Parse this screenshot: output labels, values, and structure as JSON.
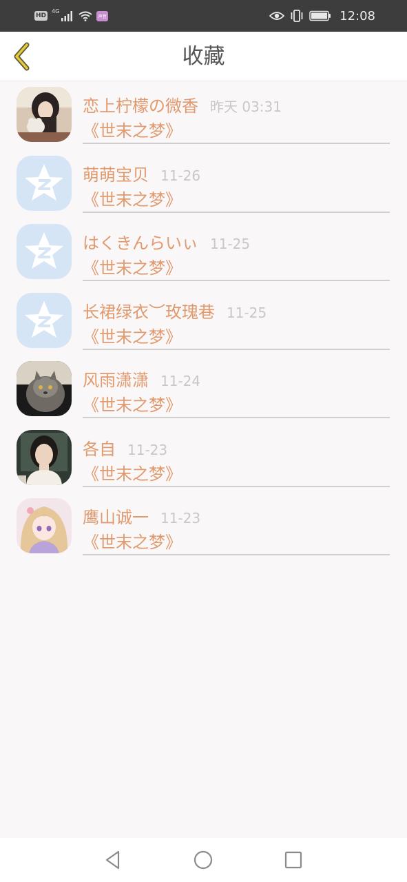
{
  "status_bar": {
    "hd_label": "HD",
    "network_label": "4G",
    "app_badge_label": "声音",
    "time": "12:08",
    "icons": [
      "signal-icon",
      "wifi-icon",
      "eye-icon",
      "vibrate-icon",
      "battery-icon"
    ]
  },
  "header": {
    "title": "收藏",
    "back_icon": "chevron-left-icon",
    "back_color": "#e8c93a"
  },
  "favorites": [
    {
      "name": "恋上柠檬の微香",
      "time": "昨天 03:31",
      "book": "《世末之梦》",
      "avatar": "photo-girl-with-toy"
    },
    {
      "name": "萌萌宝贝",
      "time": "11-26",
      "book": "《世末之梦》",
      "avatar": "qq-default-avatar"
    },
    {
      "name": "はくきんらいぃ",
      "time": "11-25",
      "book": "《世末之梦》",
      "avatar": "qq-default-avatar"
    },
    {
      "name": "长裙绿衣︶玫瑰巷",
      "time": "11-25",
      "book": "《世末之梦》",
      "avatar": "qq-default-avatar"
    },
    {
      "name": "风雨潇潇",
      "time": "11-24",
      "book": "《世末之梦》",
      "avatar": "photo-cat"
    },
    {
      "name": "各自",
      "time": "11-23",
      "book": "《世末之梦》",
      "avatar": "photo-girl-portrait"
    },
    {
      "name": "鹰山诚一",
      "time": "11-23",
      "book": "《世末之梦》",
      "avatar": "anime-girl-illustration"
    }
  ],
  "colors": {
    "accent_text": "#e09a6e",
    "time_text": "#c8c8c8",
    "background": "#f9f7f8",
    "status_bar": "#3d3d3d"
  },
  "nav": {
    "icons": [
      "back-triangle-icon",
      "home-circle-icon",
      "recents-square-icon"
    ]
  }
}
